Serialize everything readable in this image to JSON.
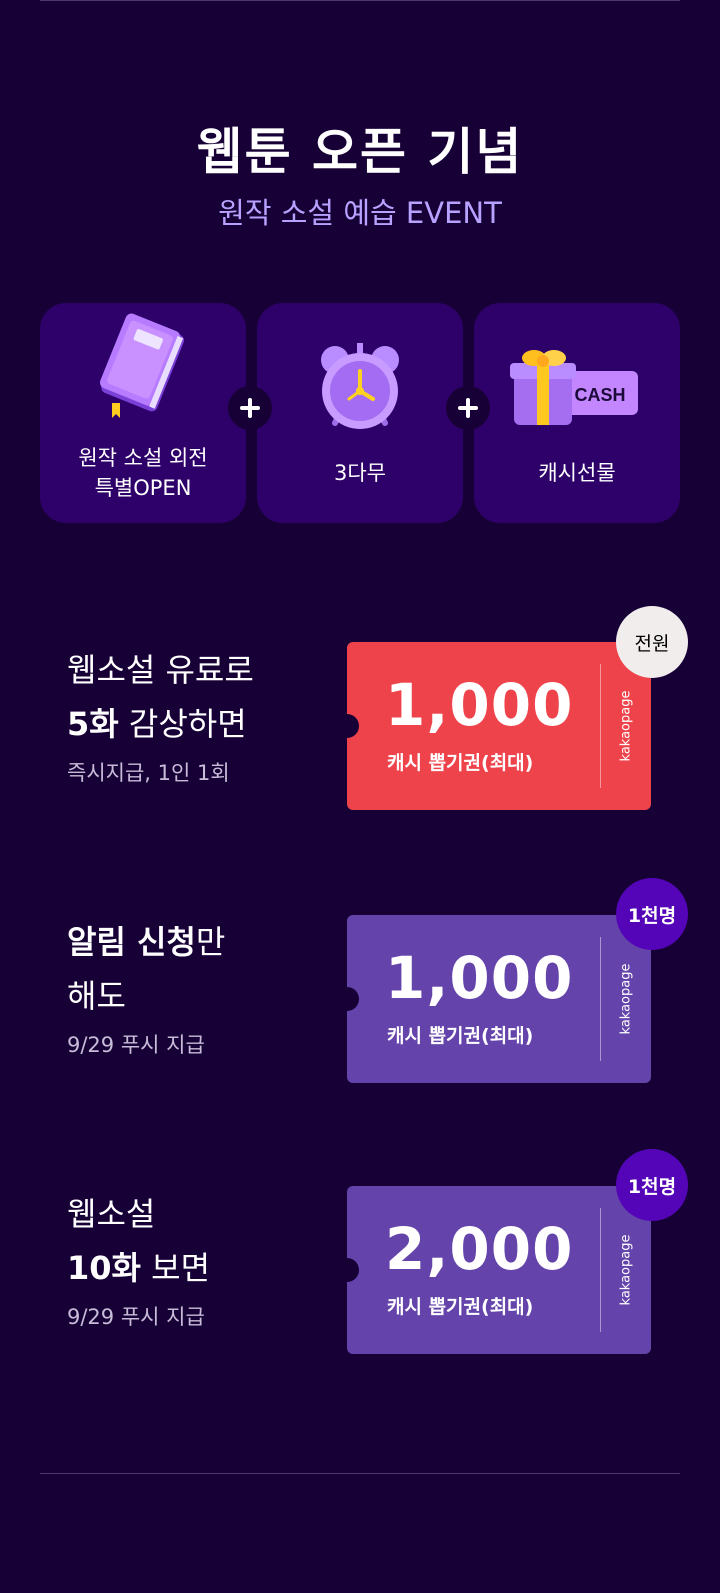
{
  "header": {
    "title": "웹툰 오픈 기념",
    "subtitle": "원작 소설 예습 EVENT"
  },
  "features": [
    {
      "icon": "book-icon",
      "label_line1": "원작 소설 외전",
      "label_line2": "특별OPEN"
    },
    {
      "icon": "alarm-clock-icon",
      "label_line1": "3다무",
      "label_line2": ""
    },
    {
      "icon": "gift-cash-icon",
      "label_line1": "캐시선물",
      "label_line2": "",
      "cash_text": "CASH"
    }
  ],
  "events": [
    {
      "line1": "웹소설 유료로",
      "line2_strong": "5화",
      "line2_rest": " 감상하면",
      "sub": "즉시지급, 1인 1회",
      "amount": "1,000",
      "caption": "캐시 뽑기권(최대)",
      "brand": "kakaopage",
      "badge": "전원",
      "ticket_color": "#ee434b"
    },
    {
      "line1_strong": "알림 신청",
      "line1_rest": "만",
      "line2": "해도",
      "sub": "9/29 푸시 지급",
      "amount": "1,000",
      "caption": "캐시 뽑기권(최대)",
      "brand": "kakaopage",
      "badge": "1천명",
      "ticket_color": "#6443aa"
    },
    {
      "line1": "웹소설",
      "line2_strong": "10화",
      "line2_rest": " 보면",
      "sub": "9/29 푸시 지급",
      "amount": "2,000",
      "caption": "캐시 뽑기권(최대)",
      "brand": "kakaopage",
      "badge": "1천명",
      "ticket_color": "#6443aa"
    }
  ],
  "colors": {
    "background": "#170035",
    "card": "#2e0069",
    "accent_text": "#b7a2ff",
    "badge_violet": "#5405b8"
  }
}
